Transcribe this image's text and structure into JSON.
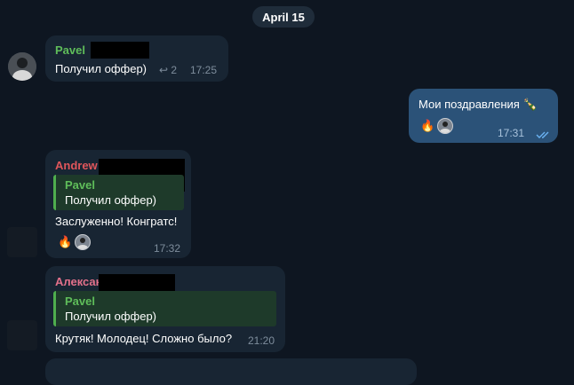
{
  "date_separator": "April 15",
  "messages": [
    {
      "id": "m1",
      "sender": "Pavel",
      "text": "Получил оффер)",
      "reply_count": "↩ 2",
      "time": "17:25"
    },
    {
      "id": "m2",
      "text": "Мои поздравления 🍾",
      "time": "17:31",
      "read_status": "double-check-icon",
      "reaction": "🔥"
    },
    {
      "id": "m3",
      "sender": "Andrew",
      "reply_to_name": "Pavel",
      "reply_to_text": "Получил оффер)",
      "text": "Заслуженно! Конгратс!",
      "time": "17:32",
      "reaction": "🔥"
    },
    {
      "id": "m4",
      "sender": "Алексан",
      "reply_to_name": "Pavel",
      "reply_to_text": "Получил оффер)",
      "text": "Крутяк! Молодец! Сложно было?",
      "time": "21:20"
    }
  ],
  "colors": {
    "background": "#0e1621",
    "incoming_bubble": "#182533",
    "outgoing_bubble": "#2b5278",
    "pavel_name": "#5fbd5a",
    "andrew_name": "#e0565b",
    "aleksan_name": "#e4718b"
  }
}
